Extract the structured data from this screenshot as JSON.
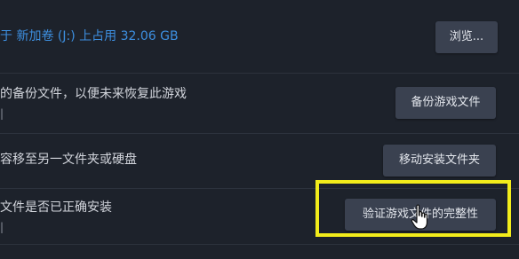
{
  "install_location": {
    "label": "于 新加卷 (J:) 上占用 32.06 GB",
    "browse_button": "浏览..."
  },
  "backup": {
    "description": "的备份文件，以便未来恢复此游戏",
    "button": "备份游戏文件"
  },
  "move": {
    "description": "容移至另一文件夹或硬盘",
    "button": "移动安装文件夹"
  },
  "verify": {
    "description": "文件是否已正确安装",
    "button": "验证游戏文件的完整性"
  },
  "colors": {
    "background": "#1d222b",
    "accent_blue": "#3d8fe0",
    "button_bg": "#3a4150",
    "highlight_box": "#f2ec1b"
  },
  "icons": {
    "cursor": "hand-pointer-icon"
  }
}
